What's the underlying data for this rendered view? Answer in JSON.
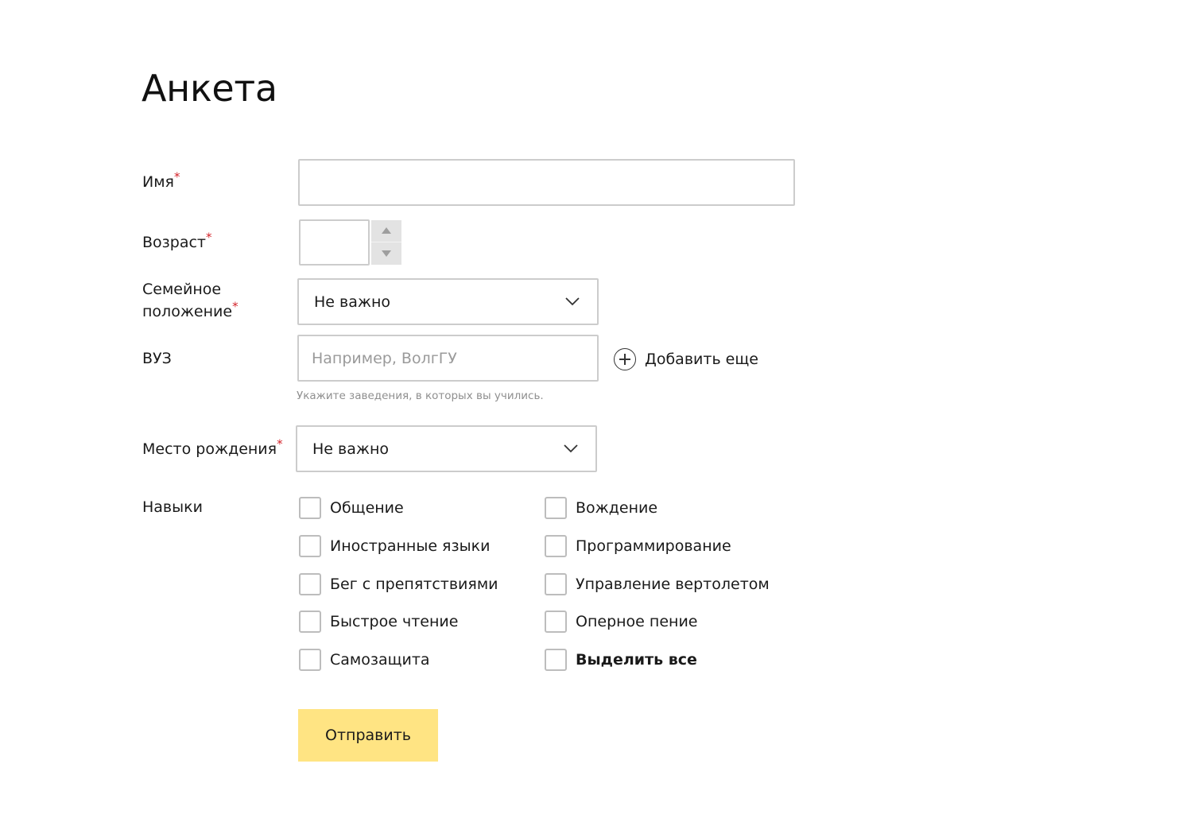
{
  "page": {
    "title": "Анкета"
  },
  "required_mark": "*",
  "fields": {
    "name": {
      "label": "Имя",
      "value": ""
    },
    "age": {
      "label": "Возраст",
      "value": ""
    },
    "marital": {
      "label_line1": "Семейное",
      "label_line2": "положение",
      "value": "Не важно"
    },
    "university": {
      "label": "ВУЗ",
      "placeholder": "Например, ВолгГУ",
      "hint": "Укажите заведения, в которых вы учились.",
      "add_more": "Добавить еще"
    },
    "birthplace": {
      "label": "Место рождения",
      "value": "Не важно"
    }
  },
  "skills": {
    "label": "Навыки",
    "left": [
      "Общение",
      "Иностранные языки",
      "Бег с препятствиями",
      "Быстрое чтение",
      "Самозащита"
    ],
    "right": [
      "Вождение",
      "Программирование",
      "Управление вертолетом",
      "Оперное пение"
    ],
    "select_all": "Выделить все"
  },
  "submit_label": "Отправить",
  "colors": {
    "submit_bg": "#ffe483",
    "required": "#d4262d",
    "border": "#cccccc",
    "hint": "#8f8f8f"
  },
  "icons": {
    "select_arrow": "chevron-down-icon",
    "add_more": "plus-circle-icon",
    "spin_up": "triangle-up-icon",
    "spin_down": "triangle-down-icon"
  }
}
